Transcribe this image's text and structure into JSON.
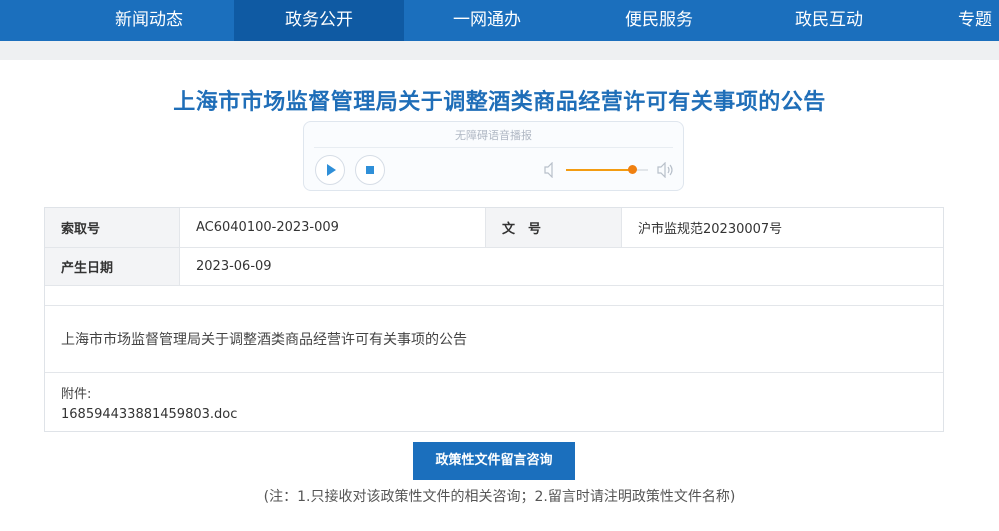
{
  "nav": {
    "items": [
      {
        "label": "新闻动态",
        "active": false
      },
      {
        "label": "政务公开",
        "active": true
      },
      {
        "label": "一网通办",
        "active": false
      },
      {
        "label": "便民服务",
        "active": false
      },
      {
        "label": "政民互动",
        "active": false
      },
      {
        "label": "专题",
        "active": false
      }
    ]
  },
  "article": {
    "title": "上海市市场监督管理局关于调整酒类商品经营许可有关事项的公告"
  },
  "player": {
    "label": "无障碍语音播报",
    "play_icon": "play-icon",
    "stop_icon": "stop-icon",
    "volume_level": 0.8,
    "accent_color": "#f39c12"
  },
  "info": {
    "index_label": "索取号",
    "index_value": "AC6040100-2023-009",
    "doc_label": "文　号",
    "doc_value": "沪市监规范20230007号",
    "date_label": "产生日期",
    "date_value": "2023-06-09",
    "body": "上海市市场监督管理局关于调整酒类商品经营许可有关事项的公告",
    "attachment_label": "附件:",
    "attachment_file": "168594433881459803.doc"
  },
  "consult": {
    "button_label": "政策性文件留言咨询",
    "note": "(注：1.只接收对该政策性文件的相关咨询；2.留言时请注明政策性文件名称)"
  },
  "colors": {
    "primary": "#1b6fbd",
    "nav_active": "#0f5aa3",
    "title": "#1f6eb8"
  }
}
